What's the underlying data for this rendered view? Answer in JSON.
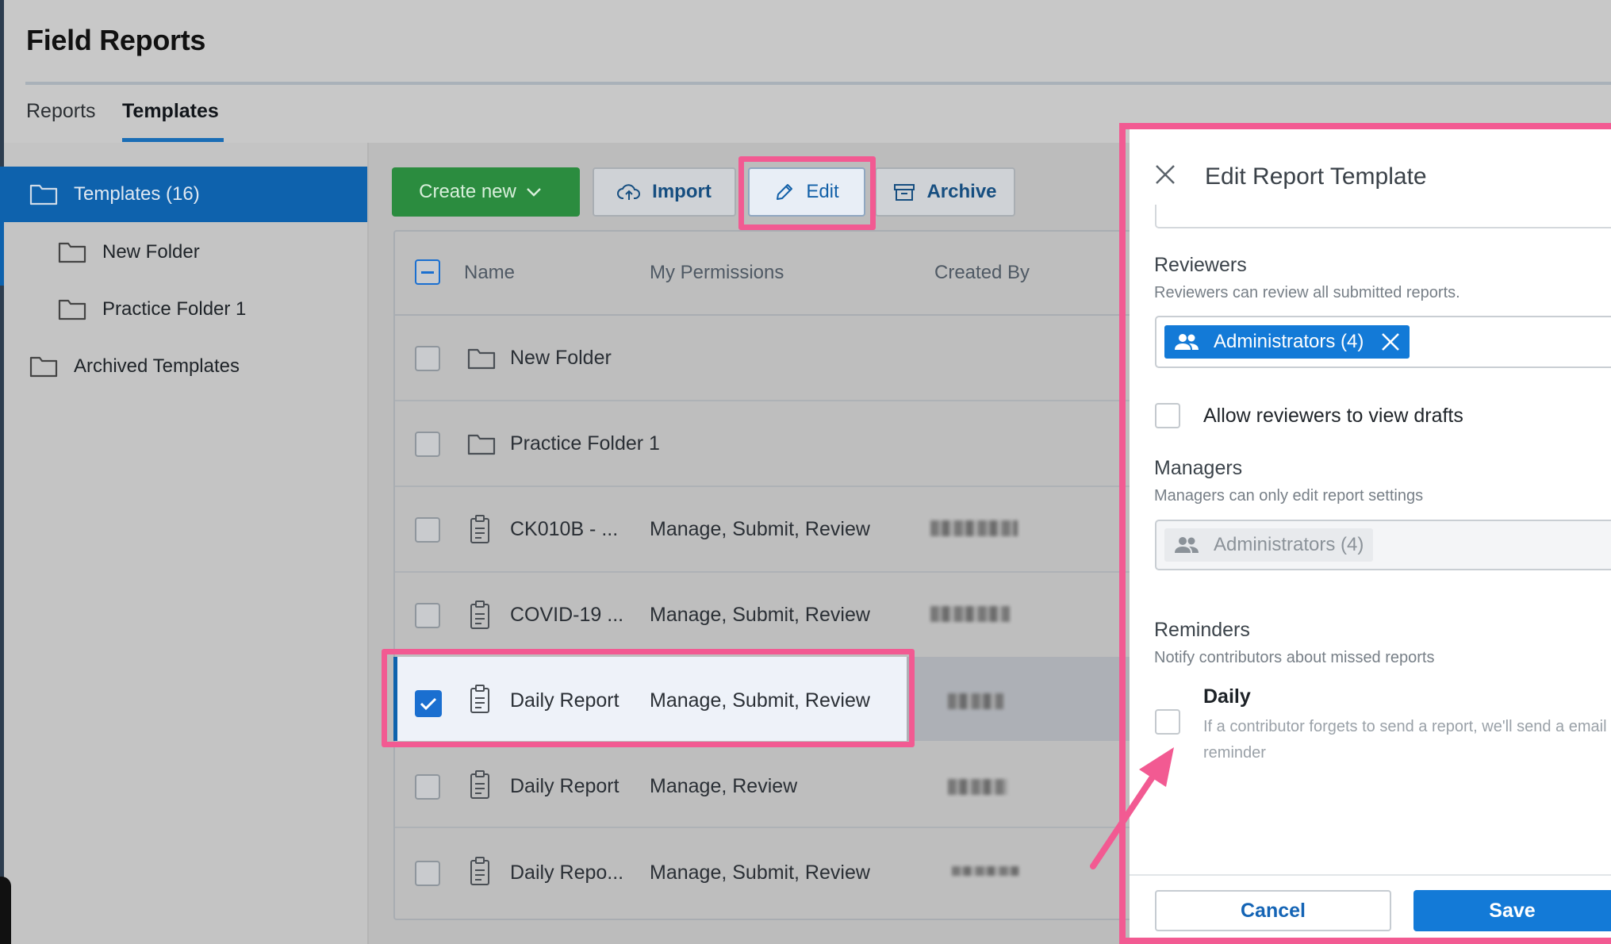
{
  "app": {
    "title": "Field Reports"
  },
  "tabs": [
    {
      "label": "Reports"
    },
    {
      "label": "Templates"
    }
  ],
  "sidebar": {
    "items": [
      {
        "label": "Templates (16)"
      },
      {
        "label": "New Folder"
      },
      {
        "label": "Practice Folder 1"
      },
      {
        "label": "Archived Templates"
      }
    ]
  },
  "toolbar": {
    "create_label": "Create new",
    "import_label": "Import",
    "edit_label": "Edit",
    "archive_label": "Archive"
  },
  "table": {
    "columns": [
      "Name",
      "My Permissions",
      "Created By"
    ],
    "rows": [
      {
        "name": "New Folder",
        "permissions": "",
        "type": "folder",
        "selected": false
      },
      {
        "name": "Practice Folder 1",
        "permissions": "",
        "type": "folder",
        "selected": false
      },
      {
        "name": "CK010B - ...",
        "permissions": "Manage, Submit, Review",
        "type": "template",
        "selected": false
      },
      {
        "name": "COVID-19 ...",
        "permissions": "Manage, Submit, Review",
        "type": "template",
        "selected": false
      },
      {
        "name": "Daily Report",
        "permissions": "Manage, Submit, Review",
        "type": "template",
        "selected": true
      },
      {
        "name": "Daily Report",
        "permissions": "Manage, Review",
        "type": "template",
        "selected": false
      },
      {
        "name": "Daily Repo...",
        "permissions": "Manage, Submit, Review",
        "type": "template",
        "selected": false
      }
    ]
  },
  "panel": {
    "title": "Edit Report Template",
    "reviewers": {
      "label": "Reviewers",
      "description": "Reviewers can review all submitted reports.",
      "chip": "Administrators (4)"
    },
    "allow_drafts_label": "Allow reviewers to view drafts",
    "managers": {
      "label": "Managers",
      "description": "Managers can only edit report settings",
      "chip": "Administrators (4)"
    },
    "reminders": {
      "label": "Reminders",
      "description": "Notify contributors about missed reports",
      "daily_label": "Daily",
      "daily_description": "If a contributor forgets to send a report, we'll send a email reminder"
    },
    "cancel_label": "Cancel",
    "save_label": "Save"
  },
  "colors": {
    "accent": "#137ad7",
    "create_button": "#2b8c3f",
    "highlight": "#f25a92"
  }
}
